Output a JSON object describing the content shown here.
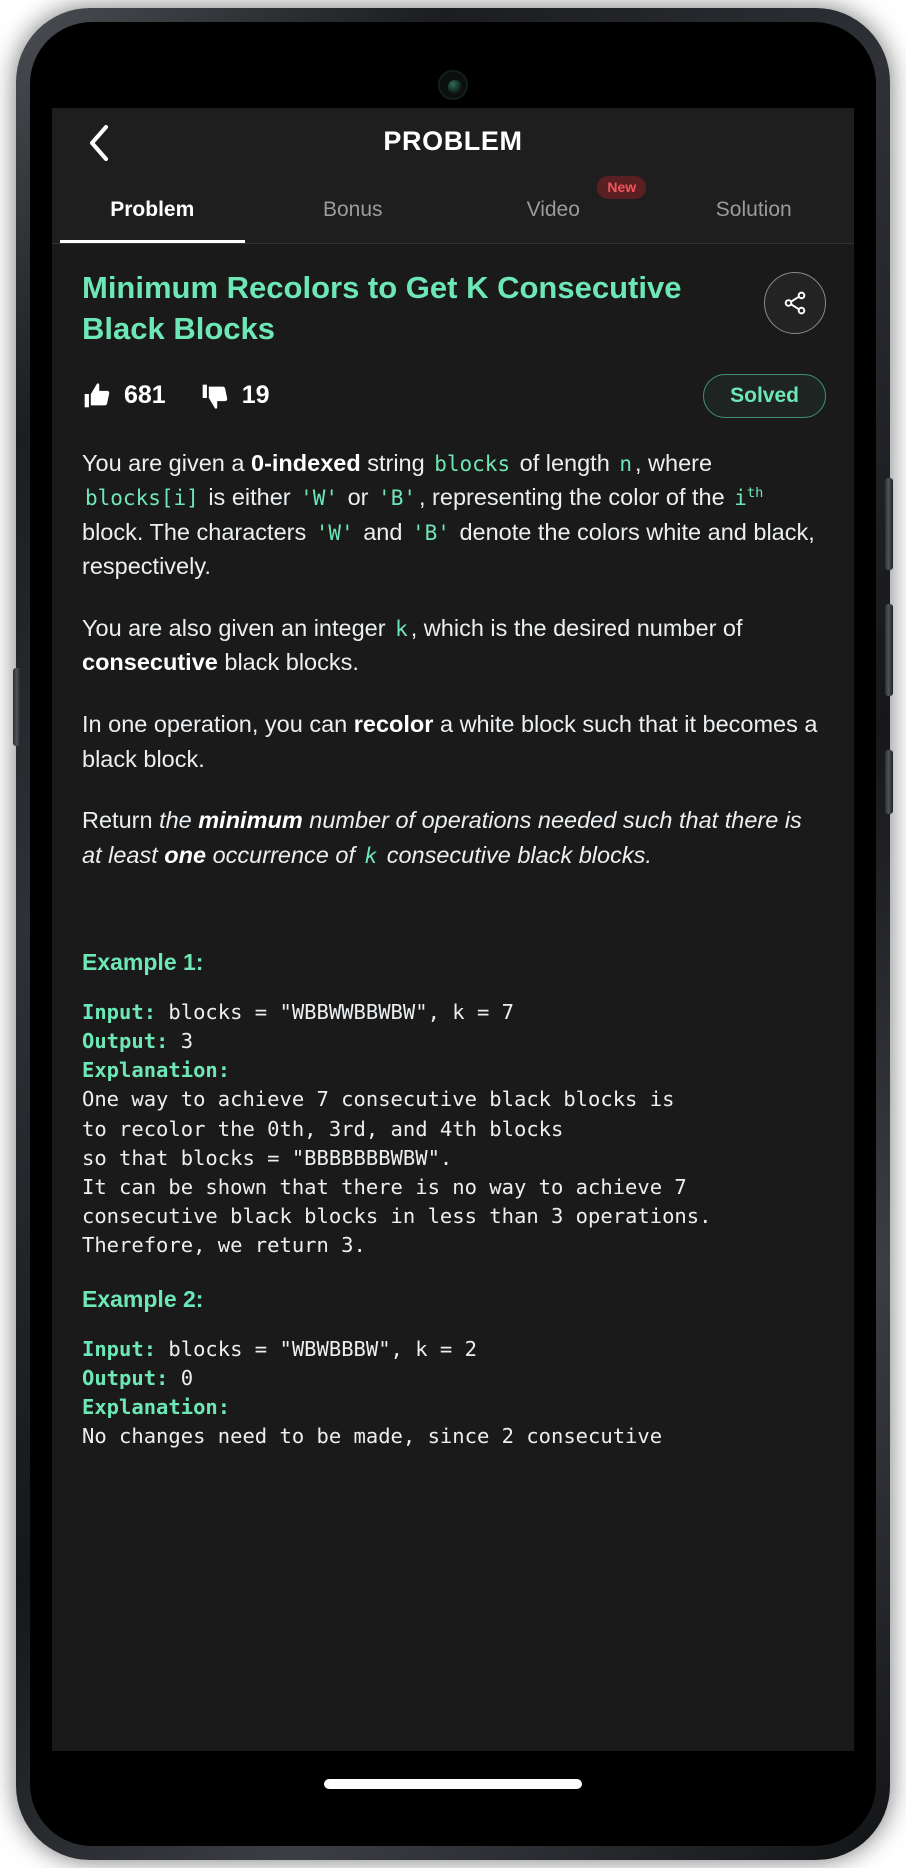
{
  "header": {
    "title": "PROBLEM",
    "back_icon": "chevron-left-icon"
  },
  "tabs": [
    {
      "label": "Problem",
      "active": true,
      "badge": null
    },
    {
      "label": "Bonus",
      "active": false,
      "badge": null
    },
    {
      "label": "Video",
      "active": false,
      "badge": "New"
    },
    {
      "label": "Solution",
      "active": false,
      "badge": null
    }
  ],
  "problem": {
    "title": "Minimum Recolors to Get K Consecutive Black Blocks",
    "share_icon": "share-icon",
    "likes": "681",
    "dislikes": "19",
    "status_badge": "Solved"
  },
  "description": {
    "p1": {
      "t1": "You are given a ",
      "b1": "0-indexed",
      "t2": " string ",
      "c1": "blocks",
      "t3": " of length ",
      "c2": "n",
      "t4": ", where ",
      "c3": "blocks[i]",
      "t5": " is either ",
      "c4": "'W'",
      "t6": " or ",
      "c5": "'B'",
      "t7": ", representing the color of the ",
      "c6": "i",
      "c6sup": "th",
      "t8": " block. The characters ",
      "c7": "'W'",
      "t9": " and ",
      "c8": "'B'",
      "t10": " denote the colors white and black, respectively."
    },
    "p2": {
      "t1": "You are also given an integer ",
      "c1": "k",
      "t2": ", which is the desired number of ",
      "b1": "consecutive",
      "t3": " black blocks."
    },
    "p3": {
      "t1": "In one operation, you can ",
      "b1": "recolor",
      "t2": " a white block such that it becomes a black block."
    },
    "p4": {
      "t1": "Return ",
      "i_b1": "the ",
      "b1": "minimum",
      "t2": " number of operations needed such that there is at least ",
      "b2": "one",
      "t3": " occurrence of ",
      "c1": "k",
      "t4": " consecutive black blocks."
    }
  },
  "examples": [
    {
      "heading": "Example 1:",
      "input_label": "Input:",
      "input_value": " blocks = \"WBBWWBBWBW\", k = 7",
      "output_label": "Output:",
      "output_value": " 3",
      "explanation_label": "Explanation:",
      "explanation_value": "\nOne way to achieve 7 consecutive black blocks is\nto recolor the 0th, 3rd, and 4th blocks\nso that blocks = \"BBBBBBBWBW\".\nIt can be shown that there is no way to achieve 7\nconsecutive black blocks in less than 3 operations.\nTherefore, we return 3."
    },
    {
      "heading": "Example 2:",
      "input_label": "Input:",
      "input_value": " blocks = \"WBWBBBW\", k = 2",
      "output_label": "Output:",
      "output_value": " 0",
      "explanation_label": "Explanation:",
      "explanation_value": "\nNo changes need to be made, since 2 consecutive"
    }
  ],
  "colors": {
    "accent_green": "#6ee7b7",
    "background": "#1a1a1a",
    "header_background": "#1e1e1e",
    "badge_red": "#f0565a",
    "text": "#eceff1"
  }
}
